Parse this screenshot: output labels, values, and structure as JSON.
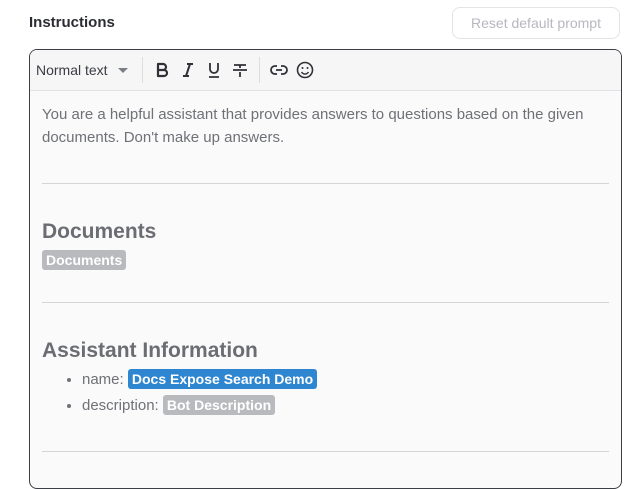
{
  "header": {
    "title": "Instructions",
    "reset_label": "Reset default prompt"
  },
  "toolbar": {
    "text_style": "Normal text",
    "buttons": [
      "bold-icon",
      "italic-icon",
      "underline-icon",
      "strikethrough-icon",
      "link-icon",
      "emoji-icon"
    ]
  },
  "editor": {
    "intro": "You are a helpful assistant that provides answers to questions based on the given documents. Don't make up answers.",
    "documents_heading": "Documents",
    "documents_chip": "Documents",
    "assistant_heading": "Assistant Information",
    "name_label": "name:",
    "name_value": "Docs Expose Search Demo",
    "description_label": "description:",
    "description_value": "Bot Description"
  },
  "colors": {
    "accent": "#2e86d0",
    "chip_gray": "#b9babd"
  }
}
